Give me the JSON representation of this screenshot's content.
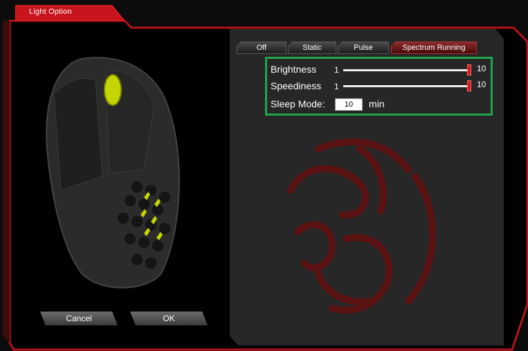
{
  "window": {
    "tab_title": "Light Option"
  },
  "modes": {
    "buttons": [
      {
        "label": "Off",
        "active": false
      },
      {
        "label": "Static",
        "active": false
      },
      {
        "label": "Pulse",
        "active": false
      },
      {
        "label": "Spectrum Running",
        "active": true
      }
    ]
  },
  "settings": {
    "brightness": {
      "label": "Brightness",
      "min": "1",
      "max": "10",
      "value": 10
    },
    "speediness": {
      "label": "Speediness",
      "min": "1",
      "max": "10",
      "value": 10
    },
    "sleep": {
      "label": "Sleep Mode:",
      "value": "10",
      "unit": "min"
    }
  },
  "actions": {
    "cancel_label": "Cancel",
    "ok_label": "OK"
  },
  "colors": {
    "accent_red": "#d21a1a",
    "highlight_green": "#1fa64a",
    "panel": "#272727"
  }
}
